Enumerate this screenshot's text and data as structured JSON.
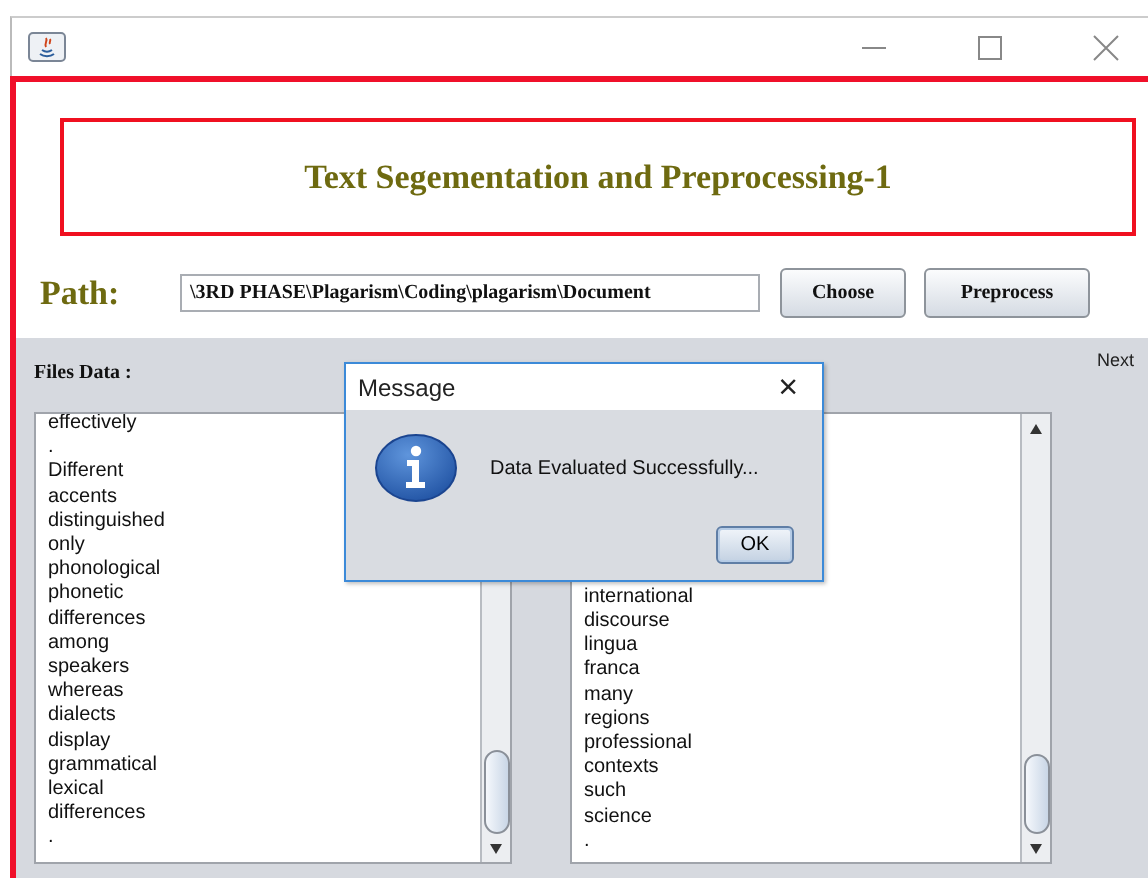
{
  "header": {
    "title": "Text Segementation and Preprocessing-1"
  },
  "path_row": {
    "label": "Path:",
    "value": "\\3RD PHASE\\Plagarism\\Coding\\plagarism\\Document",
    "buttons": [
      "Choose",
      "Preprocess"
    ]
  },
  "files_panel": {
    "label": "Files Data :",
    "next_label": "Next",
    "left_list": [
      "effectively",
      ".",
      "Different",
      "accents",
      "distinguished",
      "only",
      "phonological",
      "phonetic",
      "differences",
      "among",
      "speakers",
      "whereas",
      "dialects",
      "display",
      "grammatical",
      "lexical",
      "differences",
      "."
    ],
    "right_list": [
      "international",
      "discourse",
      "lingua",
      "franca",
      "many",
      "regions",
      "professional",
      "contexts",
      "such",
      "science",
      "."
    ]
  },
  "dialog": {
    "title": "Message",
    "close": "×",
    "message": "Data Evaluated Successfully...",
    "button": "OK"
  }
}
